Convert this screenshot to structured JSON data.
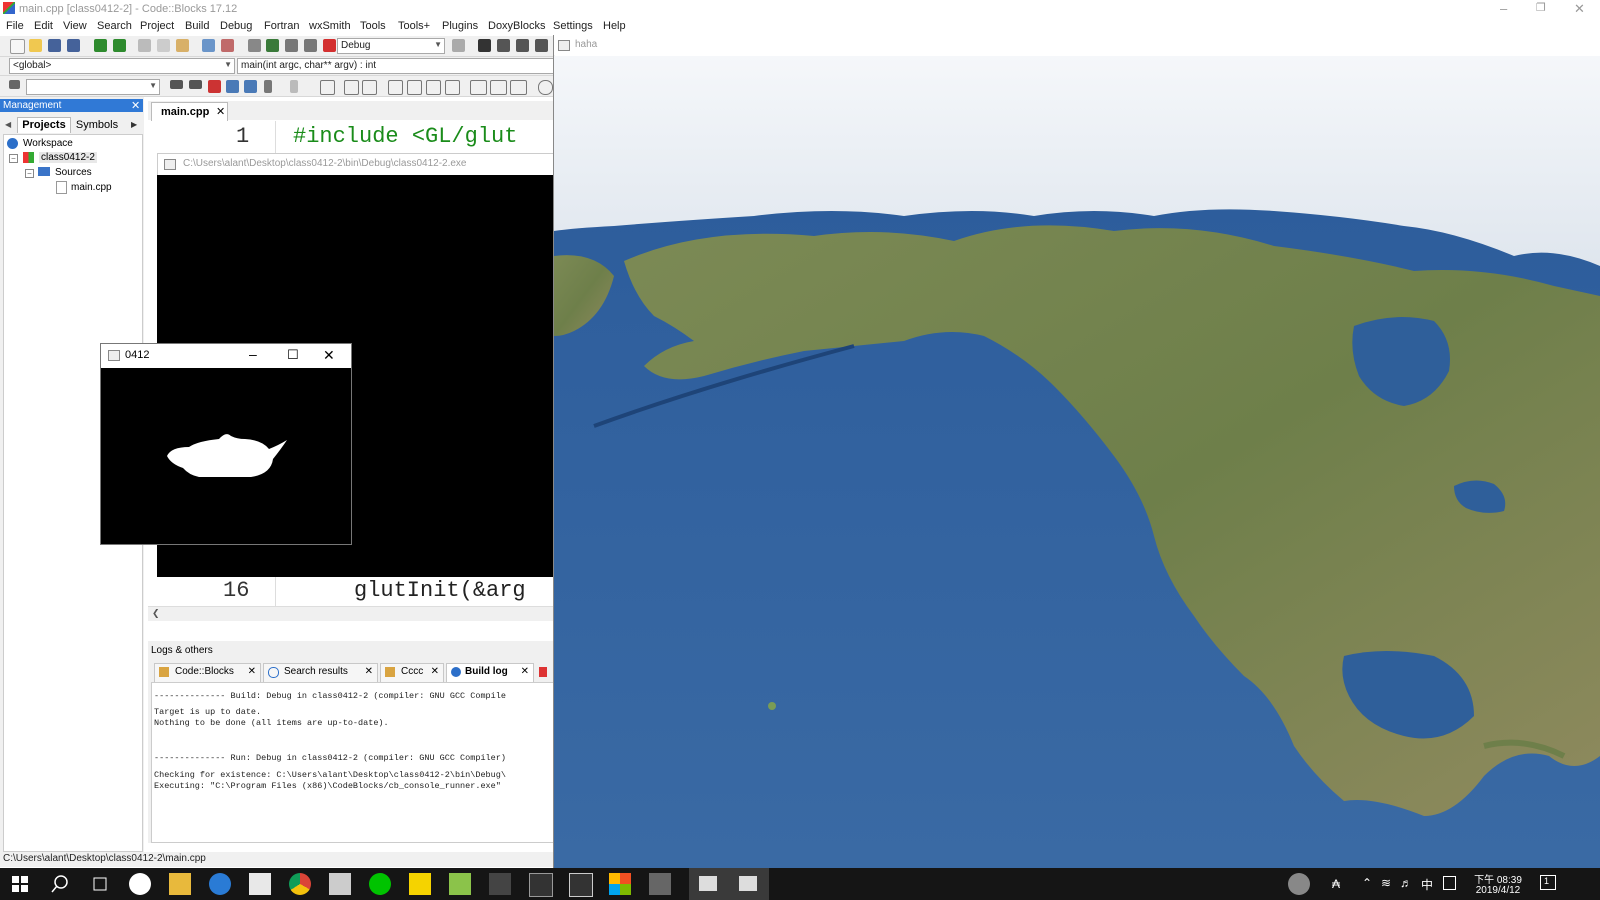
{
  "codeblocks": {
    "title": "main.cpp [class0412-2] - Code::Blocks 17.12",
    "menu": [
      "File",
      "Edit",
      "View",
      "Search",
      "Project",
      "Build",
      "Debug",
      "Fortran",
      "wxSmith",
      "Tools",
      "Tools+",
      "Plugins",
      "DoxyBlocks",
      "Settings",
      "Help"
    ],
    "build_target": "Debug",
    "scope_combo": "<global>",
    "function_combo": "main(int argc, char** argv) : int",
    "management": {
      "title": "Management",
      "tabs": [
        "Projects",
        "Symbols"
      ],
      "tree": [
        "Workspace",
        "class0412-2",
        "Sources",
        "main.cpp"
      ]
    },
    "editor": {
      "tab": "main.cpp",
      "lines": [
        {
          "num": "1",
          "code": "#include <GL/glut"
        },
        {
          "num": "16",
          "code": "glutInit(&arg"
        }
      ]
    },
    "logs": {
      "title": "Logs & others",
      "tabs": [
        "Code::Blocks",
        "Search results",
        "Cccc",
        "Build log"
      ],
      "active_tab": "Build log",
      "lines": [
        "-------------- Build: Debug in class0412-2 (compiler: GNU GCC Compile",
        "Target is up to date.",
        "Nothing to be done (all items are up-to-date).",
        "-------------- Run: Debug in class0412-2 (compiler: GNU GCC Compiler)",
        "Checking for existence: C:\\Users\\alant\\Desktop\\class0412-2\\bin\\Debug\\",
        "Executing: \"C:\\Program Files (x86)\\CodeBlocks/cb_console_runner.exe\""
      ]
    },
    "status_path": "C:\\Users\\alant\\Desktop\\class0412-2\\main.cpp"
  },
  "console_window": {
    "title": "C:\\Users\\alant\\Desktop\\class0412-2\\bin\\Debug\\class0412-2.exe"
  },
  "glut_window": {
    "title": "0412"
  },
  "map_window": {
    "title": "haha"
  },
  "taskbar": {
    "clock_time": "下午 08:39",
    "clock_date": "2019/4/12",
    "ime": "中",
    "notification_count": "1"
  },
  "colors": {
    "accent": "#3079d6",
    "taskbar": "#151515",
    "ocean": "#2f5f9a"
  }
}
